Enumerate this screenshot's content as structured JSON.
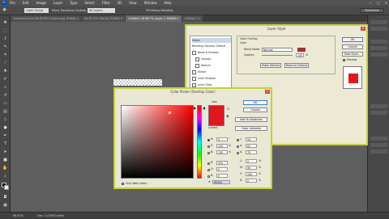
{
  "menubar": {
    "app_logo": "Ps",
    "items": [
      "File",
      "Edit",
      "Image",
      "Layer",
      "Type",
      "Select",
      "Filter",
      "3D",
      "View",
      "Window",
      "Help"
    ],
    "window_controls": [
      "−",
      "□",
      "✕"
    ]
  },
  "options_bar": {
    "field1": "Layer Group",
    "field2": "Show Transform Controls",
    "field3": "All Layers",
    "field4": "Fill Library Blending",
    "workspace": "Essentials"
  },
  "tabs": [
    {
      "label": "unnamed-ps-tut-flat @ 50% (tutorial.jpg, RGB/8) ×"
    },
    {
      "label": "flat @ 50% (flat art, RGB/8) ×"
    },
    {
      "label": "Untitled-1 @ 66.7% (Layer 1, RGB/8) ×"
    },
    {
      "label": "Untitled-1 ×"
    }
  ],
  "status": {
    "zoom": "66.67%",
    "doc": "Doc: 2.41M/0 bytes"
  },
  "layer_style": {
    "title": "Layer Style",
    "styles_header": "Styles",
    "blending_options": "Blending Options: Default",
    "items": [
      "Bevel & Emboss",
      "Contour",
      "Texture",
      "Stroke",
      "Inner Shadow",
      "Inner Glow"
    ],
    "group_title": "Color Overlay",
    "group_sub": "Color",
    "blend_mode_label": "Blend Mode:",
    "blend_mode_value": "Normal",
    "opacity_label": "Opacity:",
    "opacity_value": "100",
    "opacity_unit": "%",
    "make_default": "Make Default",
    "reset_default": "Reset to Default",
    "ok": "OK",
    "cancel": "Cancel",
    "new_style": "New Style...",
    "preview_label": "Preview",
    "overlay_color": "#e3151d"
  },
  "color_picker": {
    "title": "Color Picker (Overlay Color)",
    "new_label": "new",
    "current_label": "current",
    "ok": "OK",
    "cancel": "Cancel",
    "add_swatches": "Add To Swatches",
    "color_libraries": "Color Libraries",
    "only_web": "Only Web Colors",
    "color": "#e3151d",
    "hsb": [
      {
        "label": "H:",
        "value": "0",
        "unit": "°"
      },
      {
        "label": "S:",
        "value": "100",
        "unit": "%"
      },
      {
        "label": "B:",
        "value": "100",
        "unit": "%"
      }
    ],
    "rgb": [
      {
        "label": "R:",
        "value": "255"
      },
      {
        "label": "G:",
        "value": "0"
      },
      {
        "label": "B:",
        "value": "0"
      }
    ],
    "lab": [
      {
        "label": "L:",
        "value": "54"
      },
      {
        "label": "a:",
        "value": "81"
      },
      {
        "label": "b:",
        "value": "70"
      }
    ],
    "cmyk": [
      {
        "label": "C:",
        "value": "0",
        "unit": "%"
      },
      {
        "label": "M:",
        "value": "99",
        "unit": "%"
      },
      {
        "label": "Y:",
        "value": "100",
        "unit": "%"
      },
      {
        "label": "K:",
        "value": "0",
        "unit": "%"
      }
    ],
    "hex_label": "#",
    "hex": "ff0000"
  }
}
